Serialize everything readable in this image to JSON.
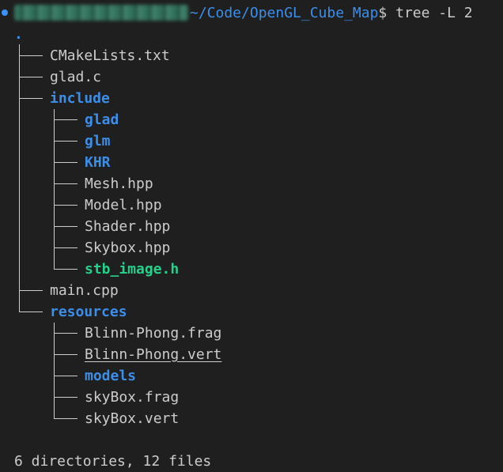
{
  "prompt": {
    "path": "~/Code/OpenGL_Cube_Map",
    "symbol": "$",
    "command": "tree -L 2"
  },
  "tree": {
    "root": ".",
    "level1": [
      {
        "name": "CMakeLists.txt",
        "kind": "file"
      },
      {
        "name": "glad.c",
        "kind": "file"
      },
      {
        "name": "include",
        "kind": "dir"
      },
      {
        "name": "main.cpp",
        "kind": "file"
      },
      {
        "name": "resources",
        "kind": "dir"
      }
    ],
    "include_children": [
      {
        "name": "glad",
        "kind": "dir"
      },
      {
        "name": "glm",
        "kind": "dir"
      },
      {
        "name": "KHR",
        "kind": "dir"
      },
      {
        "name": "Mesh.hpp",
        "kind": "file"
      },
      {
        "name": "Model.hpp",
        "kind": "file"
      },
      {
        "name": "Shader.hpp",
        "kind": "file"
      },
      {
        "name": "Skybox.hpp",
        "kind": "file"
      },
      {
        "name": "stb_image.h",
        "kind": "exe"
      }
    ],
    "resources_children": [
      {
        "name": "Blinn-Phong.frag",
        "kind": "file"
      },
      {
        "name": "Blinn-Phong.vert",
        "kind": "file"
      },
      {
        "name": "models",
        "kind": "dir"
      },
      {
        "name": "skyBox.frag",
        "kind": "file"
      },
      {
        "name": "skyBox.vert",
        "kind": "file"
      }
    ]
  },
  "summary": "6 directories, 12 files",
  "colors": {
    "background": "#1f1f1f",
    "directory": "#3b8eea",
    "executable": "#23d18b",
    "text": "#cccccc"
  }
}
